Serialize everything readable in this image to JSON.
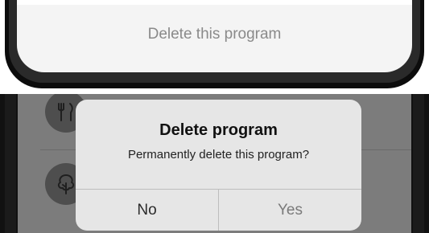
{
  "top": {
    "delete_label": "Delete this program"
  },
  "dialog": {
    "title": "Delete program",
    "message": "Permanently delete this program?",
    "no_label": "No",
    "yes_label": "Yes"
  },
  "list": {
    "icons": [
      "fork-knife-icon",
      "tree-icon"
    ]
  },
  "colors": {
    "screen_dim": "#7c7c7c",
    "dialog_bg": "#e6e6e6",
    "bezel": "#0c0c0c"
  }
}
